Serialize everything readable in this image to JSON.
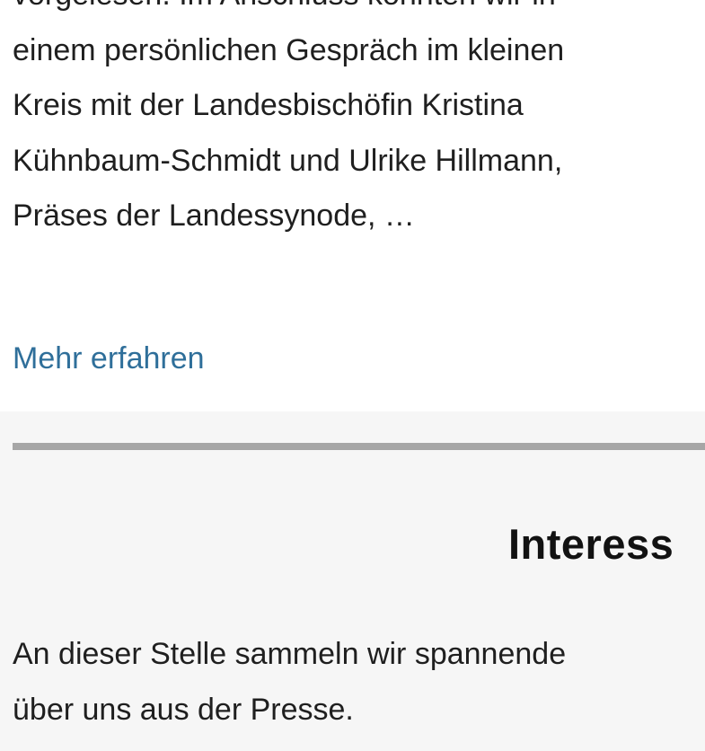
{
  "article": {
    "lines": [
      "vorgelesen. Im Anschluss konnten wir in",
      "einem persönlichen Gespräch im kleinen",
      "Kreis mit der Landesbischöfin Kristina",
      "Kühnbaum-Schmidt und Ulrike Hillmann,",
      "Präses der Landessynode, …"
    ],
    "more_link": "Mehr erfahren"
  },
  "press": {
    "heading": "Interess",
    "lines": [
      "An dieser Stelle sammeln wir spannende",
      "über uns aus der Presse."
    ]
  },
  "colors": {
    "link": "#2f6f9a",
    "text": "#1f1f1f",
    "section_bg": "#f6f6f6",
    "divider": "#a6a6a6"
  }
}
